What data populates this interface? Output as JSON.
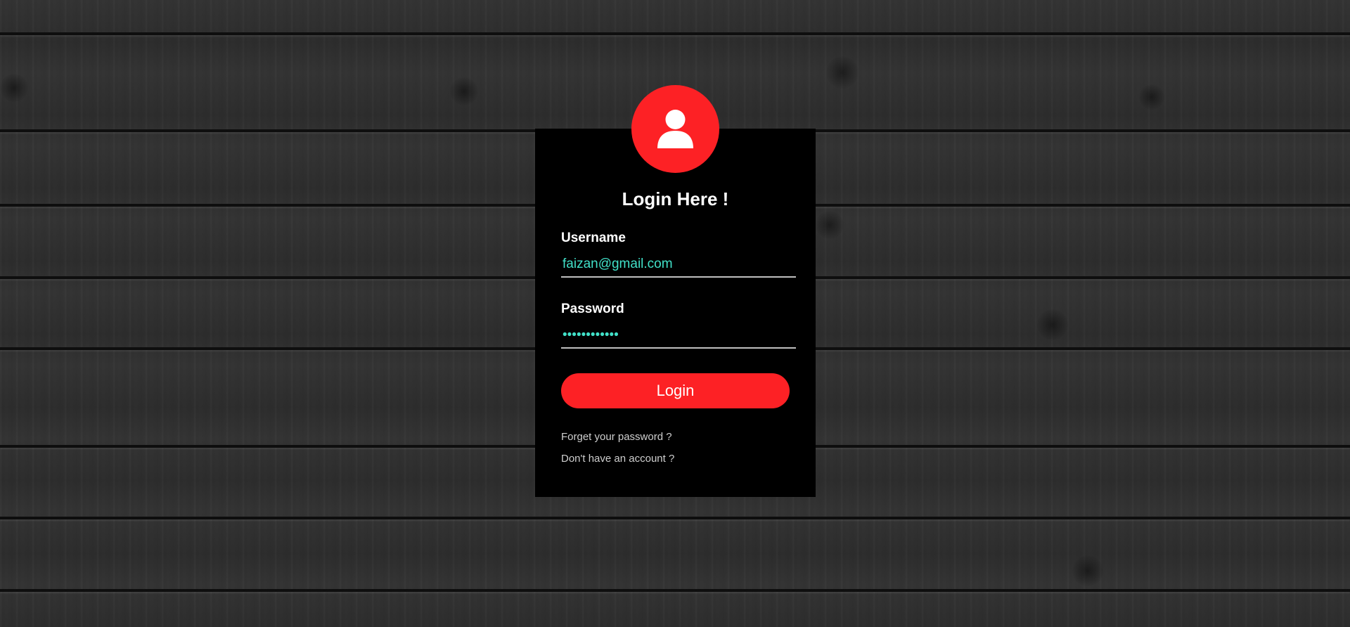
{
  "background": {
    "style": "dark wood planks"
  },
  "avatar": {
    "icon": "user-icon",
    "color": "#fd2125"
  },
  "login_form": {
    "title": "Login Here !",
    "username": {
      "label": "Username",
      "value": "faizan@gmail.com"
    },
    "password": {
      "label": "Password",
      "value": "••••••••••••"
    },
    "submit_label": "Login",
    "forgot_password_link": "Forget your password ?",
    "signup_link": "Don't have an account ?"
  },
  "colors": {
    "accent": "#fd2125",
    "input_text": "#41e0c8",
    "card_background": "#000000"
  }
}
